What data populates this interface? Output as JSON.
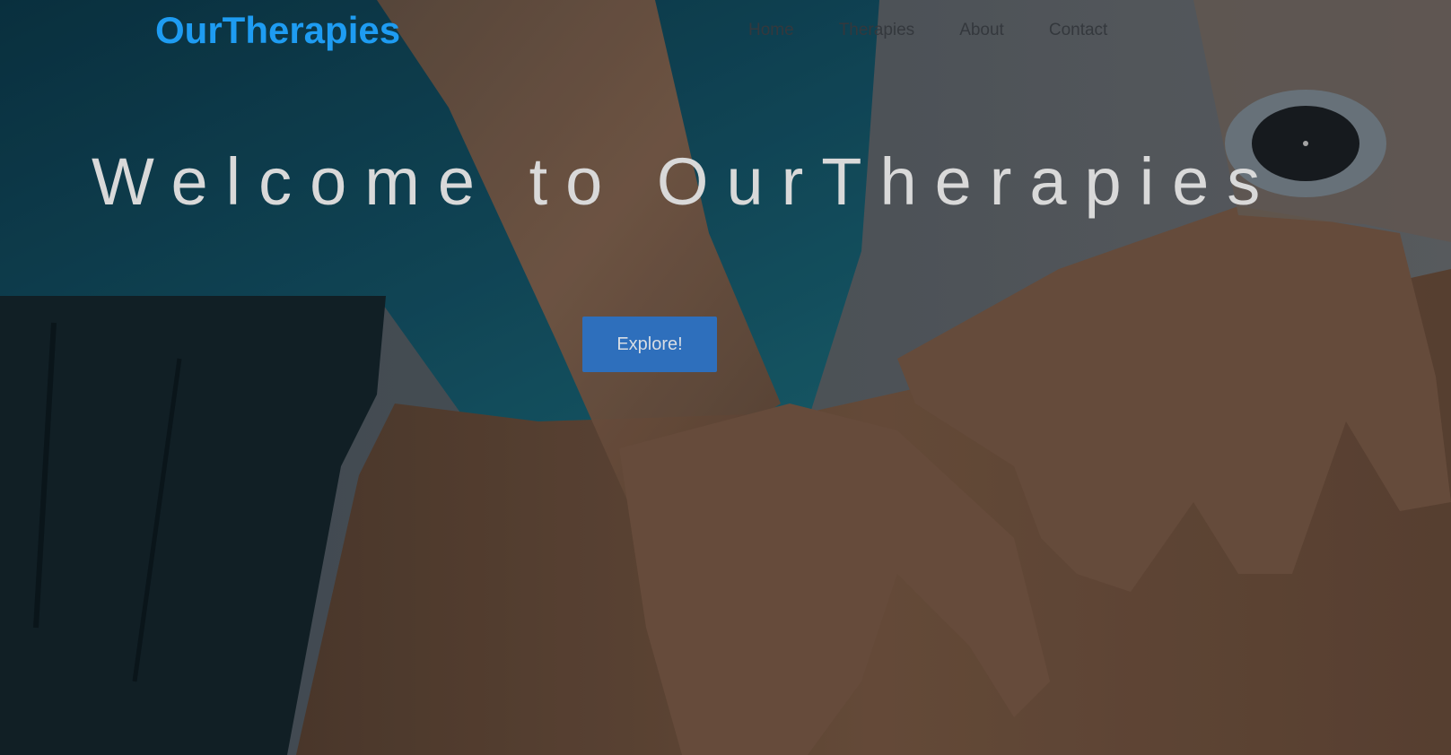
{
  "header": {
    "logo_text": "OurTherapies",
    "nav": [
      {
        "label": "Home"
      },
      {
        "label": "Therapies"
      },
      {
        "label": "About"
      },
      {
        "label": "Contact"
      }
    ]
  },
  "hero": {
    "title": "Welcome to OurTherapies",
    "cta_label": "Explore!",
    "background": "massage-therapy-photo"
  },
  "colors": {
    "brand": "#1e9cf2",
    "cta": "#2e6fbc",
    "title": "#d9d9d9",
    "nav_text": "#34383d"
  }
}
